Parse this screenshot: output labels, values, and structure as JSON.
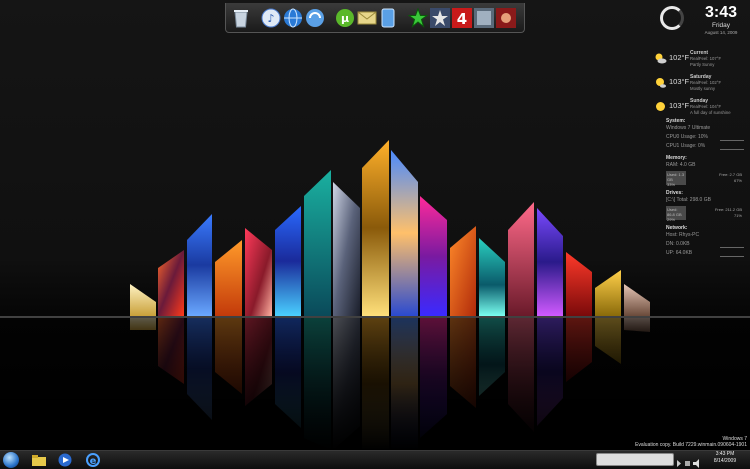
{
  "clock": {
    "time": "3:43",
    "day": "Friday",
    "date": "August 14, 2009"
  },
  "weather": [
    {
      "temp": "102°F",
      "label": "Current",
      "line2": "RealFeel: 107°F",
      "line3": "Partly Sunny"
    },
    {
      "temp": "103°F",
      "label": "Saturday",
      "line2": "RealFeel: 102°F",
      "line3": "Mostly sunny"
    },
    {
      "temp": "103°F",
      "label": "Sunday",
      "line2": "RealFeel: 104°F",
      "line3": "A full day of sunshine"
    }
  ],
  "system": {
    "heading": "System:",
    "os": "Windows 7 Ultimate",
    "cpu0": "CPU0 Usage: 10%",
    "cpu1": "CPU1 Usage: 0%",
    "memory_heading": "Memory:",
    "ram": "RAM: 4.0 GB",
    "ram_used": "Used: 1.3 GB",
    "ram_used_pct": "33%",
    "ram_free": "Free: 2.7 GB",
    "ram_free_pct": "67%",
    "drives_heading": "Drives:",
    "drive": "[C:\\] Total: 298.0 GB",
    "drive_used": "Used: 86.8 GB",
    "drive_used_pct": "29%",
    "drive_free": "Free: 211.2 GB",
    "drive_free_pct": "71%",
    "network_heading": "Network:",
    "host": "Host: Rhys-PC",
    "dn": "DN:   0.0KB",
    "up": "UP:   64.0KB"
  },
  "watermark": {
    "line1": "Windows 7",
    "line2": "Evaluation copy. Build 7229.winmain.090604-1901"
  },
  "taskbar": {
    "time": "3:43 PM",
    "date": "8/14/2009"
  },
  "icons": {
    "dock": [
      "recycle-bin-icon",
      "itunes-icon",
      "network-globe-icon",
      "refresh-globe-icon",
      "utorrent-icon",
      "envelope-icon",
      "file-icon",
      "star-game-icon",
      "star-badge-icon",
      "left4dead-icon",
      "poster-game-icon",
      "puzzle-game-icon"
    ],
    "taskbar": [
      "start-orb-icon",
      "explorer-folder-icon",
      "media-player-icon",
      "internet-explorer-icon"
    ]
  },
  "colors": {
    "taskbar": "#1a1a1a",
    "accent": "#2a73c9",
    "text": "#dddddd"
  }
}
